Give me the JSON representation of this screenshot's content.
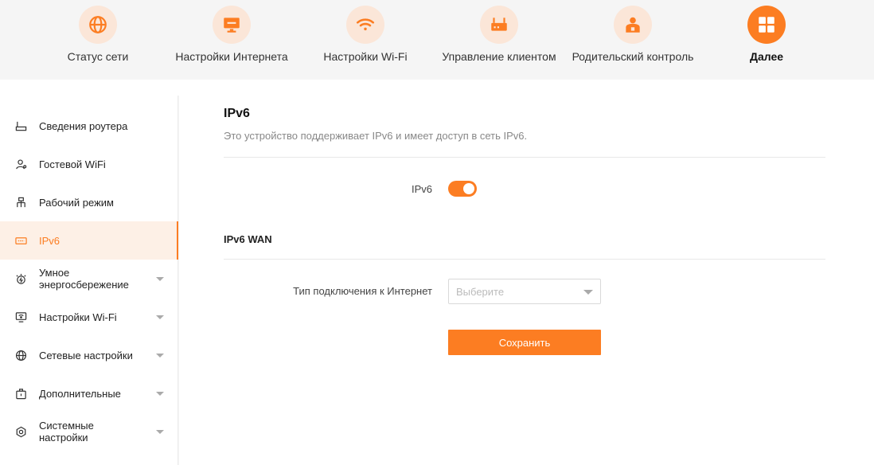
{
  "colors": {
    "accent": "#fc7d22",
    "accent_light": "#fbe6d8",
    "active_bg": "#fdf0e6"
  },
  "topnav": [
    {
      "label": "Статус сети",
      "icon": "globe-icon",
      "active": false
    },
    {
      "label": "Настройки Интернета",
      "icon": "monitor-icon",
      "active": false
    },
    {
      "label": "Настройки Wi-Fi",
      "icon": "wifi-icon",
      "active": false
    },
    {
      "label": "Управление клиентом",
      "icon": "router-icon",
      "active": false
    },
    {
      "label": "Родительский контроль",
      "icon": "parent-icon",
      "active": false
    },
    {
      "label": "Далее",
      "icon": "grid-icon",
      "active": true
    }
  ],
  "sidebar": [
    {
      "label": "Сведения роутера",
      "icon": "router-info-icon",
      "expandable": false,
      "active": false
    },
    {
      "label": "Гостевой WiFi",
      "icon": "guest-icon",
      "expandable": false,
      "active": false
    },
    {
      "label": "Рабочий режим",
      "icon": "topology-icon",
      "expandable": false,
      "active": false
    },
    {
      "label": "IPv6",
      "icon": "ipv6-icon",
      "expandable": false,
      "active": true
    },
    {
      "label": "Умное энергосбережение",
      "icon": "energy-icon",
      "expandable": true,
      "active": false
    },
    {
      "label": "Настройки Wi-Fi",
      "icon": "wifi-settings-icon",
      "expandable": true,
      "active": false
    },
    {
      "label": "Сетевые настройки",
      "icon": "network-globe-icon",
      "expandable": true,
      "active": false
    },
    {
      "label": "Дополнительные",
      "icon": "briefcase-icon",
      "expandable": true,
      "active": false
    },
    {
      "label": "Системные настройки",
      "icon": "system-gear-icon",
      "expandable": true,
      "active": false
    }
  ],
  "main": {
    "title": "IPv6",
    "subtitle": "Это устройство поддерживает IPv6 и имеет доступ в сеть IPv6.",
    "ipv6_label": "IPv6",
    "ipv6_enabled": true,
    "wan_section_title": "IPv6 WAN",
    "connection_type_label": "Тип подключения к Интернет",
    "connection_type_placeholder": "Выберите",
    "save_label": "Сохранить"
  }
}
